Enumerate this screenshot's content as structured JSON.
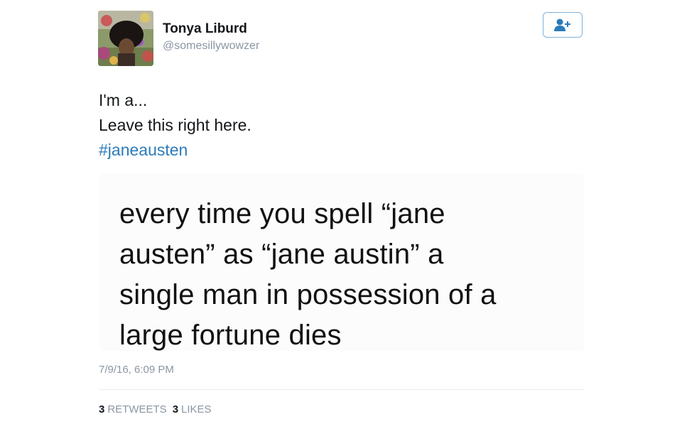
{
  "author": {
    "name": "Tonya Liburd",
    "handle": "@somesillywowzer"
  },
  "follow_icon": "add-user-icon",
  "tweet": {
    "lines": [
      "I'm a...",
      "Leave this right here."
    ],
    "hashtag": "#janeausten"
  },
  "media": {
    "lines": [
      "every time you spell “jane",
      "austen” as “jane austin” a",
      "single man in possession of a",
      "large fortune dies"
    ]
  },
  "timestamp": "7/9/16, 6:09 PM",
  "stats": {
    "retweets_count": "3",
    "retweets_label": "RETWEETS",
    "likes_count": "3",
    "likes_label": "LIKES"
  },
  "colors": {
    "link": "#2b7bb9",
    "muted": "#8a96a3",
    "follow_border": "#7fb3d9"
  }
}
